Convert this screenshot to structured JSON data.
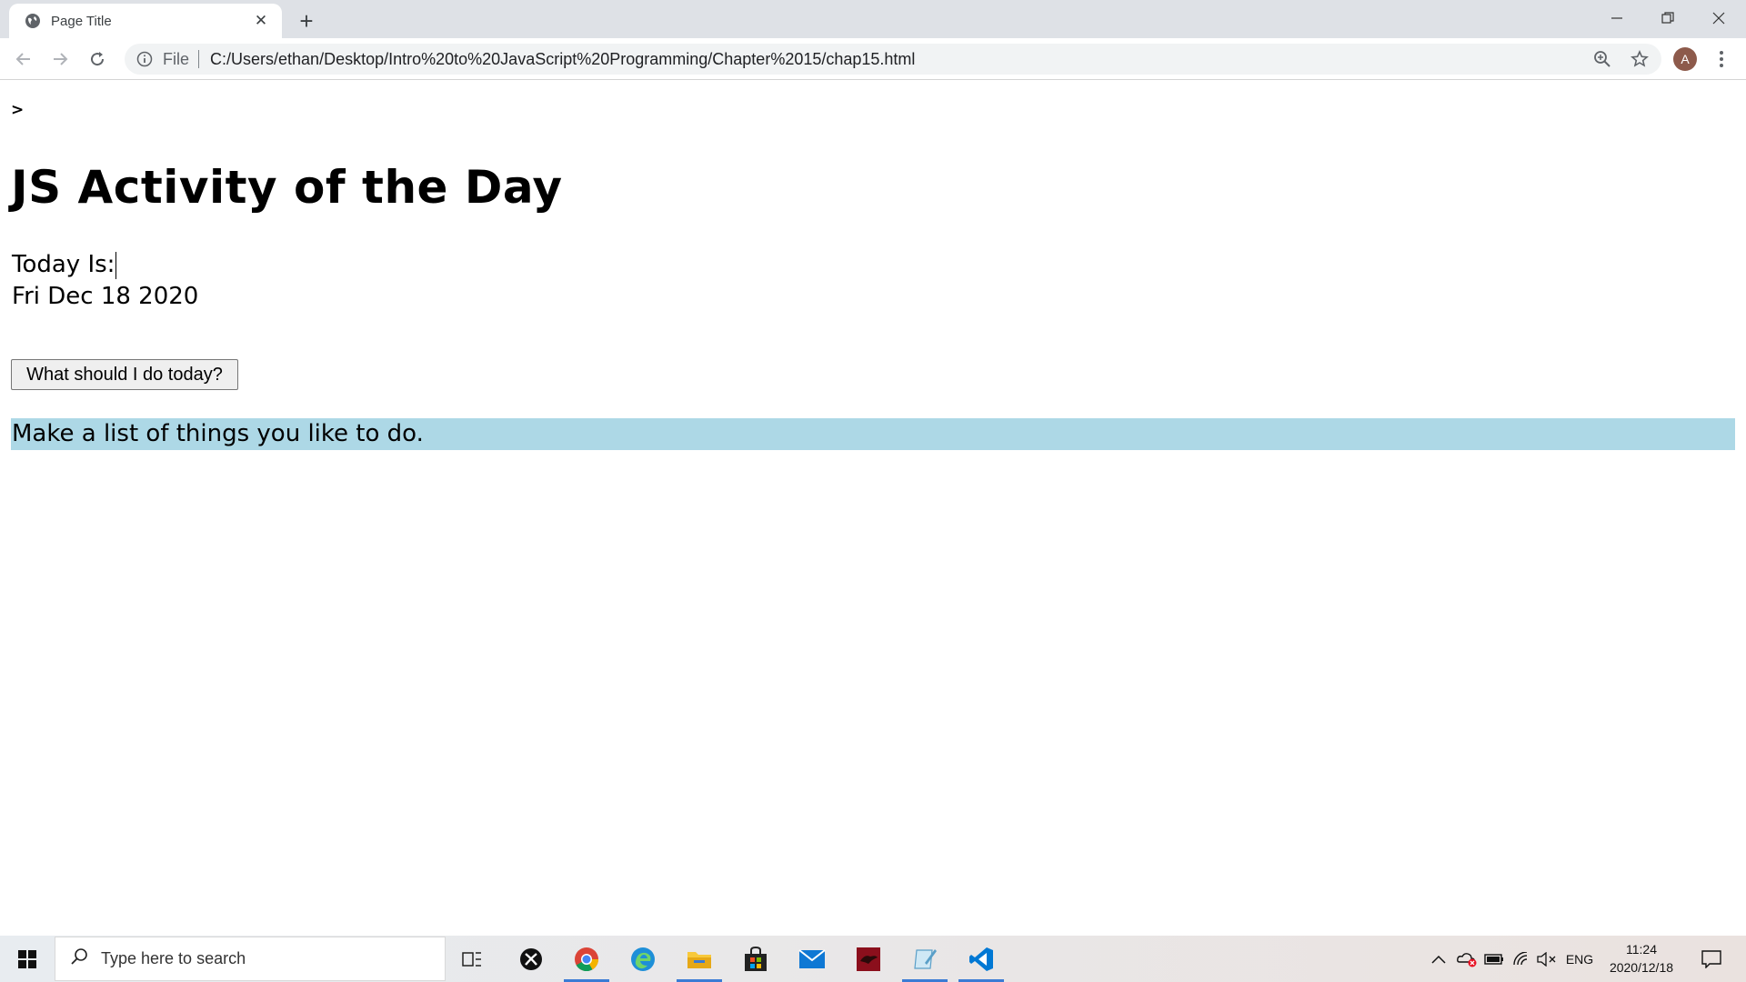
{
  "browser": {
    "tab_title": "Page Title",
    "omnibox_scheme": "File",
    "url": "C:/Users/ethan/Desktop/Intro%20to%20JavaScript%20Programming/Chapter%2015/chap15.html",
    "avatar_letter": "A"
  },
  "page": {
    "stray_text": ">",
    "heading": "JS Activity of the Day",
    "today_label": "Today Is:",
    "today_date": "Fri Dec 18 2020",
    "button_label": "What should I do today?",
    "result_text": "Make a list of things you like to do.",
    "result_background": "#add8e6"
  },
  "taskbar": {
    "search_placeholder": "Type here to search",
    "language": "ENG",
    "time": "11:24",
    "date": "2020/12/18",
    "apps": [
      "task-view",
      "xbox",
      "chrome",
      "edge",
      "file-explorer",
      "store",
      "mail",
      "app-red",
      "app-notepad",
      "vscode"
    ]
  }
}
